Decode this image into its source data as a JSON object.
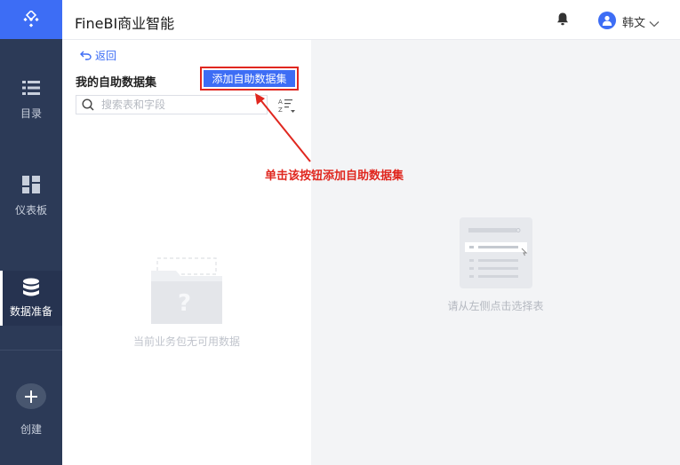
{
  "app": {
    "title": "FineBI商业智能"
  },
  "sidebar": {
    "items": [
      {
        "label": "目录",
        "icon": "list-icon"
      },
      {
        "label": "仪表板",
        "icon": "dashboard-icon"
      },
      {
        "label": "数据准备",
        "icon": "database-icon",
        "active": true
      },
      {
        "label": "创建",
        "icon": "plus-icon"
      }
    ]
  },
  "header": {
    "user_name": "韩文"
  },
  "left_panel": {
    "back_label": "返回",
    "title": "我的自助数据集",
    "add_button_label": "添加自助数据集",
    "search_placeholder": "搜索表和字段",
    "empty_text": "当前业务包无可用数据"
  },
  "right_panel": {
    "hint": "请从左侧点击选择表"
  },
  "annotation": {
    "text": "单击该按钮添加自助数据集"
  },
  "colors": {
    "sidebar": "#2c3a57",
    "accent": "#3d6df5",
    "annotation": "#e0271f",
    "right_background": "#f3f4f6"
  }
}
